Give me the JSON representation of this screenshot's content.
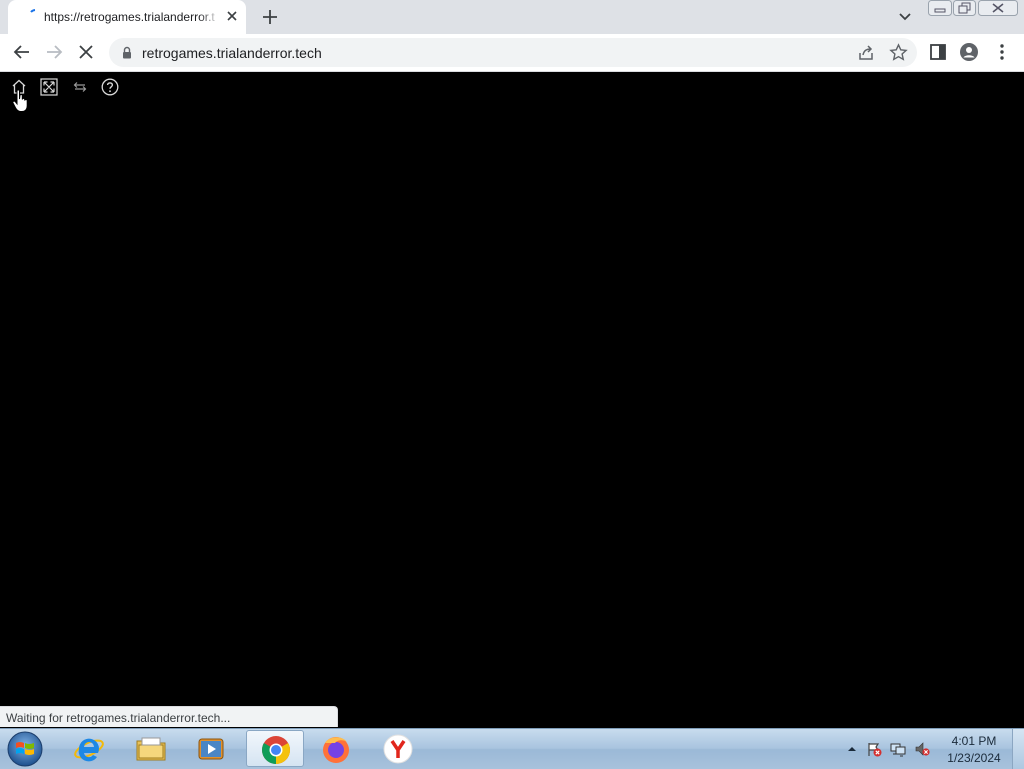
{
  "browser": {
    "tab": {
      "title": "https://retrogames.trialanderror.t"
    },
    "omnibox": {
      "url": "retrogames.trialanderror.tech"
    },
    "status_text": "Waiting for retrogames.trialanderror.tech..."
  },
  "game_toolbar": {
    "icons": [
      "home-icon",
      "fullscreen-icon",
      "swap-icon",
      "help-icon"
    ]
  },
  "taskbar": {
    "apps": [
      "internet-explorer-icon",
      "file-explorer-icon",
      "media-player-icon",
      "chrome-icon",
      "firefox-icon",
      "yandex-icon"
    ],
    "active_app": "chrome-icon",
    "clock": {
      "time": "4:01 PM",
      "date": "1/23/2024"
    }
  }
}
